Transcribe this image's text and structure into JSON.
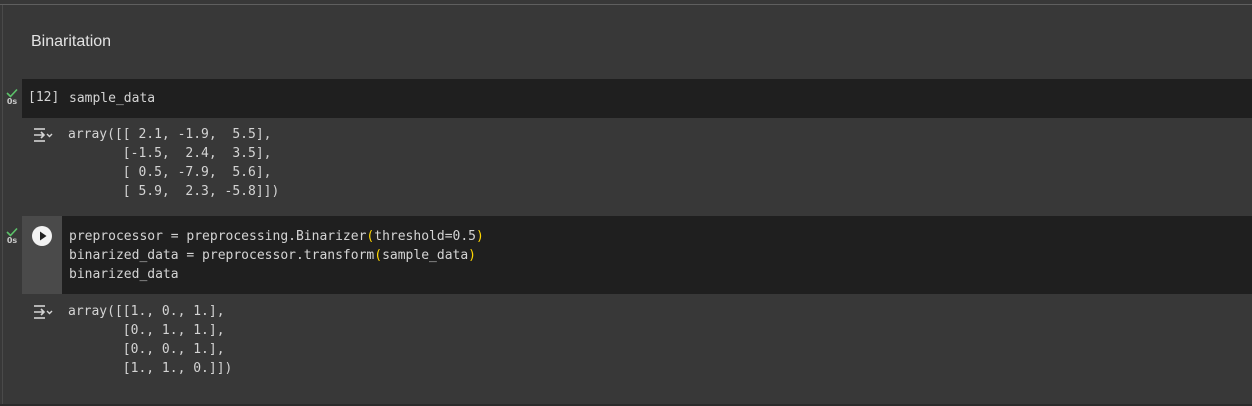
{
  "section": {
    "heading": "Binaritation"
  },
  "cells": [
    {
      "status_time": "0s",
      "exec_count": "[12]",
      "code_lines": [
        "sample_data"
      ],
      "output_lines": [
        "array([[ 2.1, -1.9,  5.5],",
        "       [-1.5,  2.4,  3.5],",
        "       [ 0.5, -7.9,  5.6],",
        "       [ 5.9,  2.3, -5.8]])"
      ]
    },
    {
      "status_time": "0s",
      "code": {
        "line1_a": "preprocessor = preprocessing.Binarizer",
        "line1_paren_open": "(",
        "line1_b": "threshold=0.5",
        "line1_paren_close": ")",
        "line2_a": "binarized_data = preprocessor.transform",
        "line2_paren_open": "(",
        "line2_b": "sample_data",
        "line2_paren_close": ")",
        "line3": "binarized_data"
      },
      "output_lines": [
        "array([[1., 0., 1.],",
        "       [0., 1., 1.],",
        "       [0., 0., 1.],",
        "       [1., 1., 0.]])"
      ]
    }
  ],
  "colors": {
    "background": "#383838",
    "code_cell_bg": "#1f1f1f",
    "check_green": "#5cc26a",
    "bracket_yellow": "#ffd700"
  },
  "icons": {
    "status": "check-icon",
    "run": "play-icon",
    "output_toggle": "output-collapse-icon"
  }
}
